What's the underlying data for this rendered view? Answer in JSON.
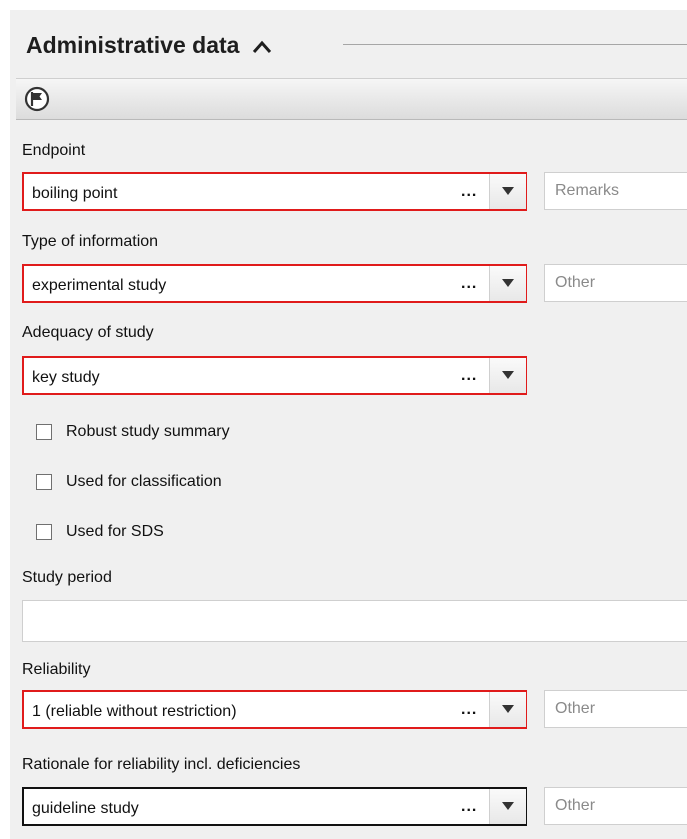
{
  "section": {
    "title": "Administrative data"
  },
  "endpoint": {
    "label": "Endpoint",
    "value": "boiling point",
    "dots": "...",
    "side_placeholder": "Remarks"
  },
  "type_of_information": {
    "label": "Type of information",
    "value": "experimental study",
    "dots": "...",
    "side_placeholder": "Other"
  },
  "adequacy": {
    "label": "Adequacy of study",
    "value": "key study",
    "dots": "..."
  },
  "checkboxes": [
    {
      "label": "Robust study summary",
      "checked": false
    },
    {
      "label": "Used for classification",
      "checked": false
    },
    {
      "label": "Used for SDS",
      "checked": false
    }
  ],
  "study_period": {
    "label": "Study period",
    "value": ""
  },
  "reliability": {
    "label": "Reliability",
    "value": "1 (reliable without restriction)",
    "dots": "...",
    "side_placeholder": "Other"
  },
  "rationale": {
    "label": "Rationale for reliability incl. deficiencies",
    "value": "guideline study",
    "dots": "...",
    "side_placeholder": "Other"
  },
  "colors": {
    "required_border": "#e01b1b",
    "panel_bg": "#f0f0f0"
  },
  "icons": {
    "collapse": "chevron-up-icon",
    "flag": "flag-icon",
    "dropdown": "triangle-down-icon"
  }
}
